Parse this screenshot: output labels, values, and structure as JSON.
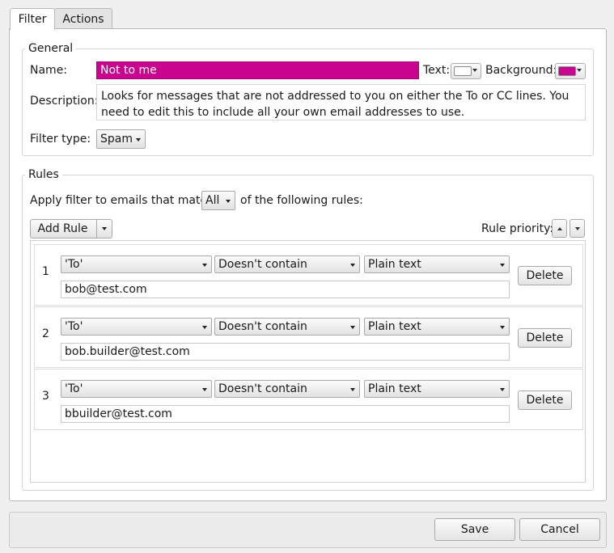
{
  "tabs": [
    {
      "label": "Filter",
      "active": true
    },
    {
      "label": "Actions",
      "active": false
    }
  ],
  "general": {
    "legend": "General",
    "name_label": "Name:",
    "name_value": "Not to me",
    "name_bg_color": "#c9058f",
    "name_text_color": "#ffffff",
    "text_color_label": "Text:",
    "background_label": "Background:",
    "description_label": "Description:",
    "description_value": "Looks for messages that are not addressed to you on either the To or CC lines.  You need to edit this to include all your own email addresses to use.",
    "filter_type_label": "Filter type:",
    "filter_type_value": "Spam"
  },
  "rules": {
    "legend": "Rules",
    "apply_prefix": "Apply filter to emails that match",
    "match_value": "All",
    "apply_suffix": "of the following rules:",
    "add_rule_label": "Add Rule",
    "priority_label": "Rule priority:",
    "items": [
      {
        "num": "1",
        "field": "'To'",
        "operator": "Doesn't contain",
        "mode": "Plain text",
        "value": "bob@test.com",
        "delete_label": "Delete"
      },
      {
        "num": "2",
        "field": "'To'",
        "operator": "Doesn't contain",
        "mode": "Plain text",
        "value": "bob.builder@test.com",
        "delete_label": "Delete"
      },
      {
        "num": "3",
        "field": "'To'",
        "operator": "Doesn't contain",
        "mode": "Plain text",
        "value": "bbuilder@test.com",
        "delete_label": "Delete"
      }
    ]
  },
  "footer": {
    "save_label": "Save",
    "cancel_label": "Cancel"
  }
}
